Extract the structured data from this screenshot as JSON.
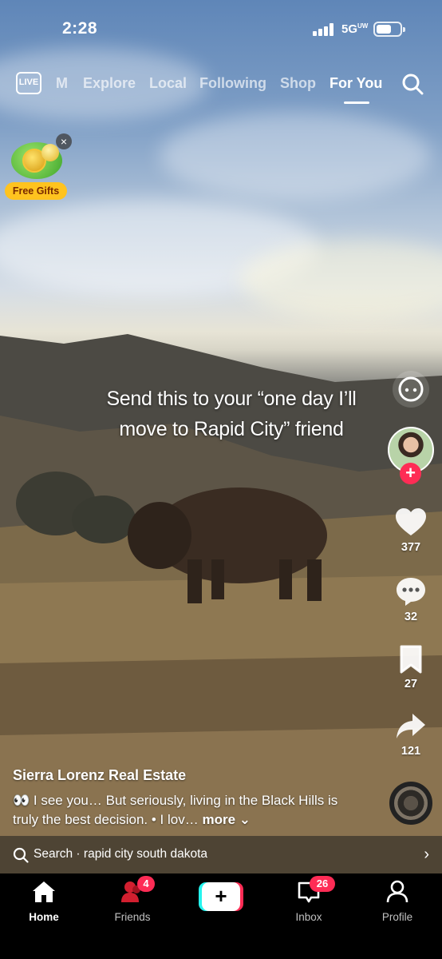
{
  "status_bar": {
    "time": "2:28",
    "network": "5G",
    "network_sub": "UW"
  },
  "top_nav": {
    "live_label": "LIVE",
    "tabs": [
      {
        "label": "M"
      },
      {
        "label": "Explore"
      },
      {
        "label": "Local"
      },
      {
        "label": "Following"
      },
      {
        "label": "Shop"
      },
      {
        "label": "For You",
        "active": true
      }
    ]
  },
  "free_gifts": {
    "label": "Free Gifts"
  },
  "video": {
    "overlay_text": "Send this to your “one day I’ll move to Rapid City” friend"
  },
  "actions": {
    "likes": "377",
    "comments": "32",
    "bookmarks": "27",
    "shares": "121"
  },
  "post": {
    "author": "Sierra Lorenz Real Estate",
    "description": "👀 I see you… But seriously, living in the Black Hills is truly the best decision. • I lov…",
    "more_label": "more"
  },
  "search_suggestion": {
    "prefix": "Search",
    "query": "rapid city south dakota"
  },
  "bottom_nav": {
    "home": "Home",
    "friends": "Friends",
    "friends_badge": "4",
    "inbox": "Inbox",
    "inbox_badge": "26",
    "profile": "Profile"
  },
  "colors": {
    "accent": "#fe2c55",
    "cyan": "#25f4ee",
    "gift": "#ffc31f"
  }
}
